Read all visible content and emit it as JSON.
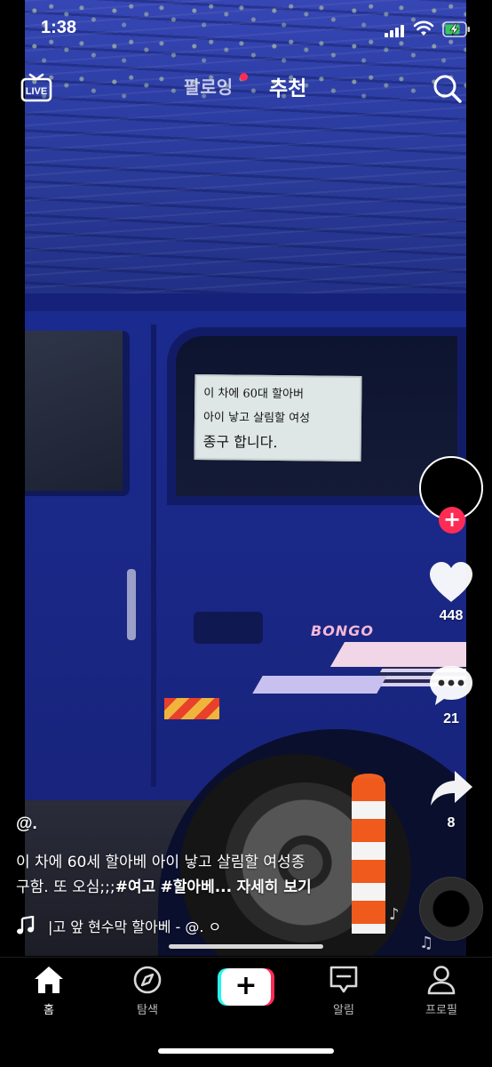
{
  "status_bar": {
    "time": "1:38"
  },
  "top_nav": {
    "live_label": "LIVE",
    "tab_following": "팔로잉",
    "tab_recommend": "추천",
    "active_tab": "추천"
  },
  "video": {
    "sign_lines": [
      "이 차에 60대 할아버",
      "아이 낳고 살림할 여성",
      "종구 합니다."
    ],
    "van_badge": "BONGO"
  },
  "actions": {
    "likes": "448",
    "comments": "21",
    "shares": "8"
  },
  "post": {
    "author": "@.",
    "caption_line1": "이 차에 60세 할아베 아이 낳고 살림할 여성종",
    "caption_line2_text": "구함.   또 오심;;;",
    "hashtag_1": "#여고",
    "hashtag_2": "#할아베...",
    "more_label": "자세히 보기",
    "sound_title": "|고 앞 현수막 할아베 - @.    ㅇ"
  },
  "bottom_nav": {
    "home": "홈",
    "discover": "탐색",
    "inbox": "알림",
    "profile": "프로필",
    "active": "홈"
  },
  "colors": {
    "accent_red": "#fe2c55",
    "accent_cyan": "#25f4ee",
    "background": "#000000"
  },
  "icons": [
    "live-icon",
    "search-icon",
    "heart-icon",
    "comment-icon",
    "share-icon",
    "music-note-icon",
    "home-icon",
    "compass-icon",
    "inbox-icon",
    "person-icon",
    "plus-icon"
  ]
}
